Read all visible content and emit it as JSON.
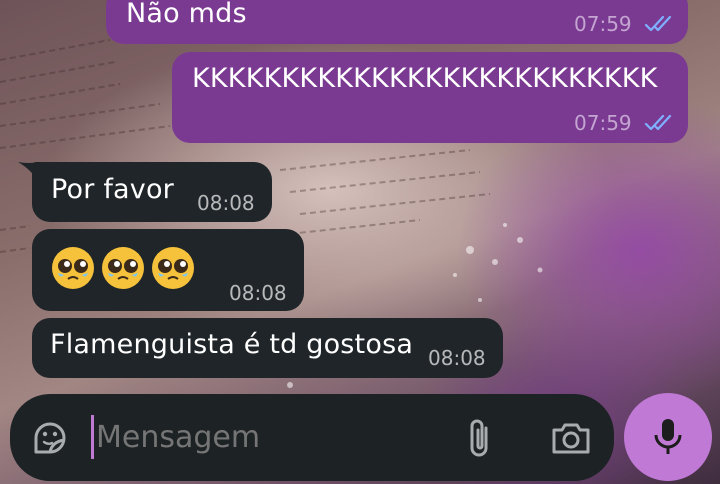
{
  "chat": {
    "messages": [
      {
        "direction": "outgoing",
        "text": "Não mds",
        "time": "07:59",
        "status": "read"
      },
      {
        "direction": "outgoing",
        "text": "KKKKKKKKKKKKKKKKKKKKKKKKKK",
        "time": "07:59",
        "status": "read"
      },
      {
        "direction": "incoming",
        "text": "Por favor",
        "time": "08:08"
      },
      {
        "direction": "incoming",
        "emojis": [
          "pleading-face",
          "pleading-face",
          "pleading-face"
        ],
        "time": "08:08"
      },
      {
        "direction": "incoming",
        "text": "Flamenguista é td gostosa",
        "time": "08:08"
      }
    ]
  },
  "composer": {
    "placeholder": "Mensagem",
    "icons": [
      "sticker-icon",
      "attach-icon",
      "camera-icon",
      "mic-icon"
    ]
  },
  "colors": {
    "outgoing_bubble": "#7b3a92",
    "incoming_bubble": "#1f2528",
    "read_ticks": "#7fb0ff",
    "mic_button": "#c07ad6",
    "cursor": "#c07ad6"
  }
}
